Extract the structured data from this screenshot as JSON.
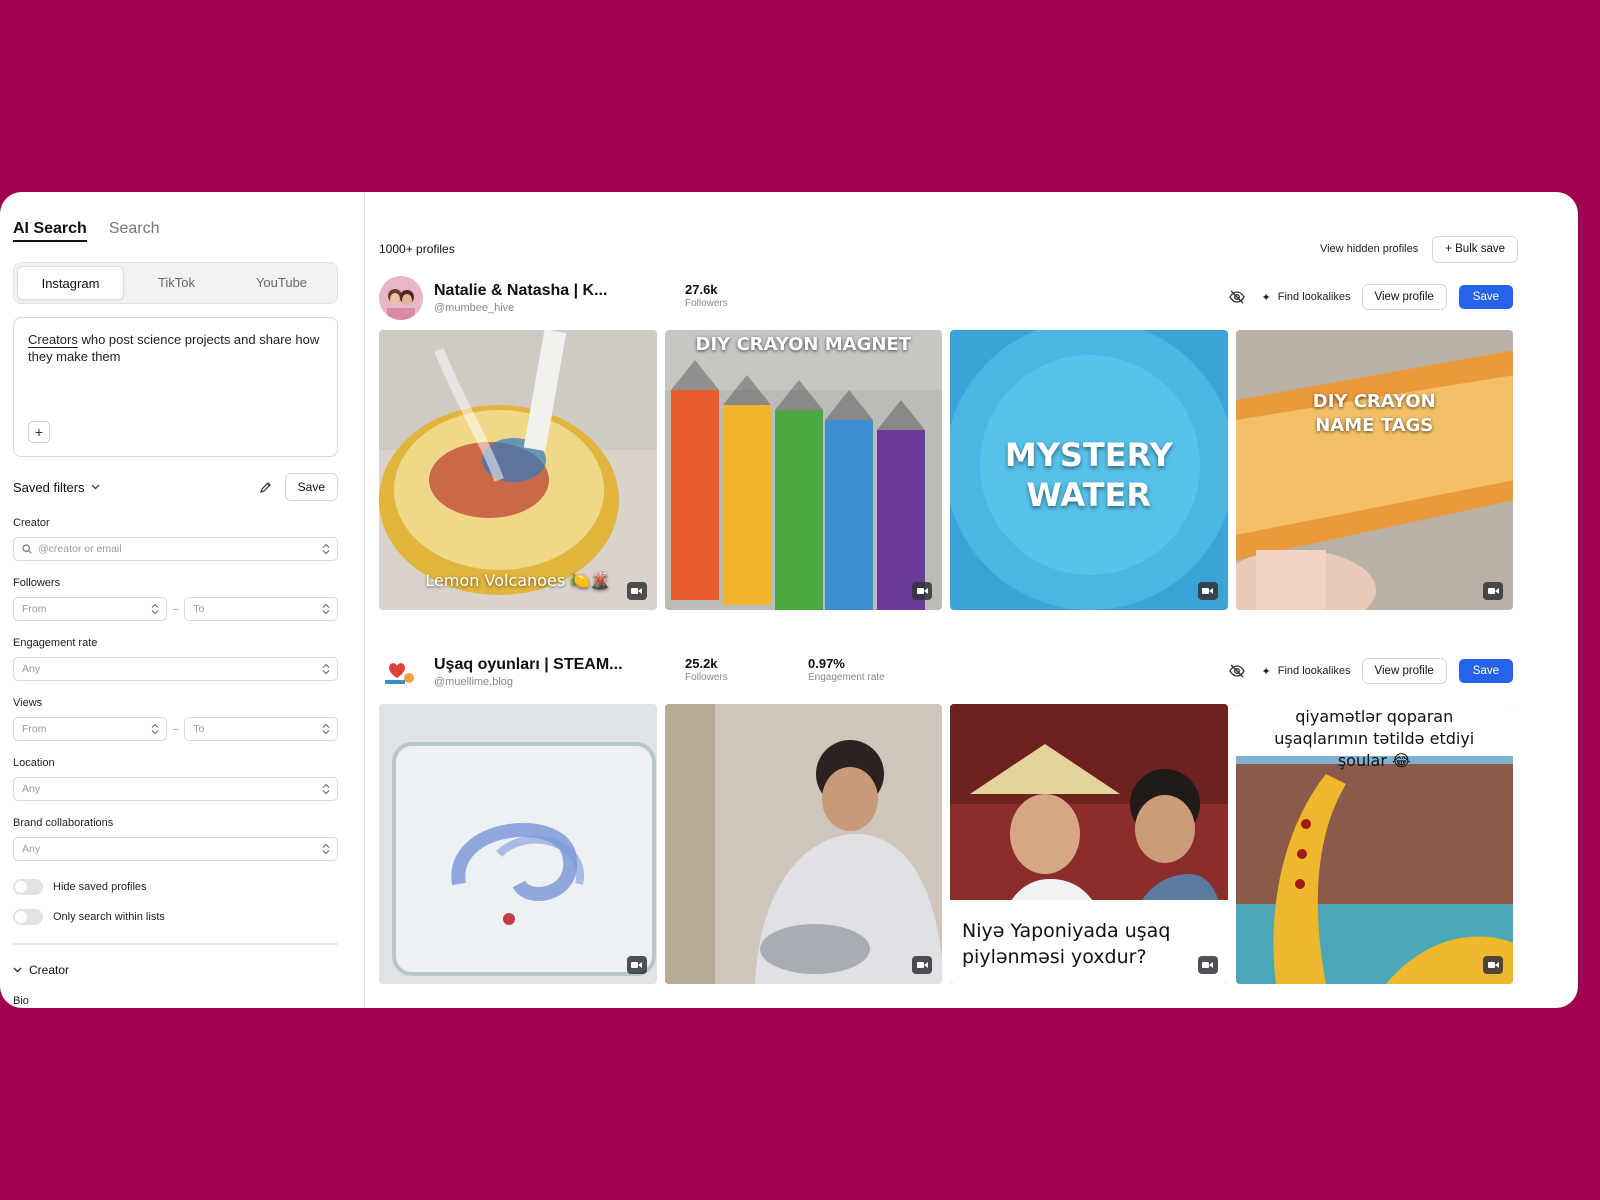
{
  "sidebar": {
    "mode_tabs": [
      "AI Search",
      "Search"
    ],
    "platforms": [
      "Instagram",
      "TikTok",
      "YouTube"
    ],
    "prompt": {
      "underlined": "Creators",
      "rest": " who post science projects and share how they make them"
    },
    "add_label": "+",
    "saved_filters": {
      "label": "Saved filters",
      "save_label": "Save"
    },
    "creator": {
      "label": "Creator",
      "placeholder": "@creator or email"
    },
    "followers": {
      "label": "Followers",
      "from": "From",
      "to": "To"
    },
    "engagement": {
      "label": "Engagement rate",
      "placeholder": "Any"
    },
    "views": {
      "label": "Views",
      "from": "From",
      "to": "To"
    },
    "location": {
      "label": "Location",
      "placeholder": "Any"
    },
    "brand": {
      "label": "Brand collaborations",
      "placeholder": "Any"
    },
    "toggles": [
      "Hide saved profiles",
      "Only search within lists"
    ],
    "section": "Creator",
    "bio": "Bio"
  },
  "main": {
    "count": "1000+ profiles",
    "view_hidden": "View hidden profiles",
    "bulk_save": "+ Bulk save",
    "find_lookalikes": "Find lookalikes",
    "view_profile": "View profile",
    "save": "Save",
    "profiles": [
      {
        "name": "Natalie & Natasha | K...",
        "handle": "@mumbee_hive",
        "followers": "27.6k",
        "followers_label": "Followers",
        "thumbs": [
          {
            "caption": "Lemon Volcanoes 🍋🌋"
          },
          {
            "caption": "DIY CRAYON MAGNET"
          },
          {
            "caption": "MYSTERY WATER"
          },
          {
            "caption": "DIY CRAYON NAME TAGS"
          }
        ]
      },
      {
        "name": "Uşaq oyunları | STEAM...",
        "handle": "@muellime.blog",
        "followers": "25.2k",
        "followers_label": "Followers",
        "engagement": "0.97%",
        "engagement_label": "Engagement rate",
        "thumbs": [
          {
            "caption": ""
          },
          {
            "caption": ""
          },
          {
            "caption": "Niyə Yaponiyada uşaq piylənməsi yoxdur?"
          },
          {
            "caption": "qiyamətlər qoparan uşaqlarımın tətildə etdiyi şoular 😂"
          }
        ]
      }
    ]
  },
  "colors": {
    "background": "#a0004e",
    "primary": "#2563eb"
  }
}
